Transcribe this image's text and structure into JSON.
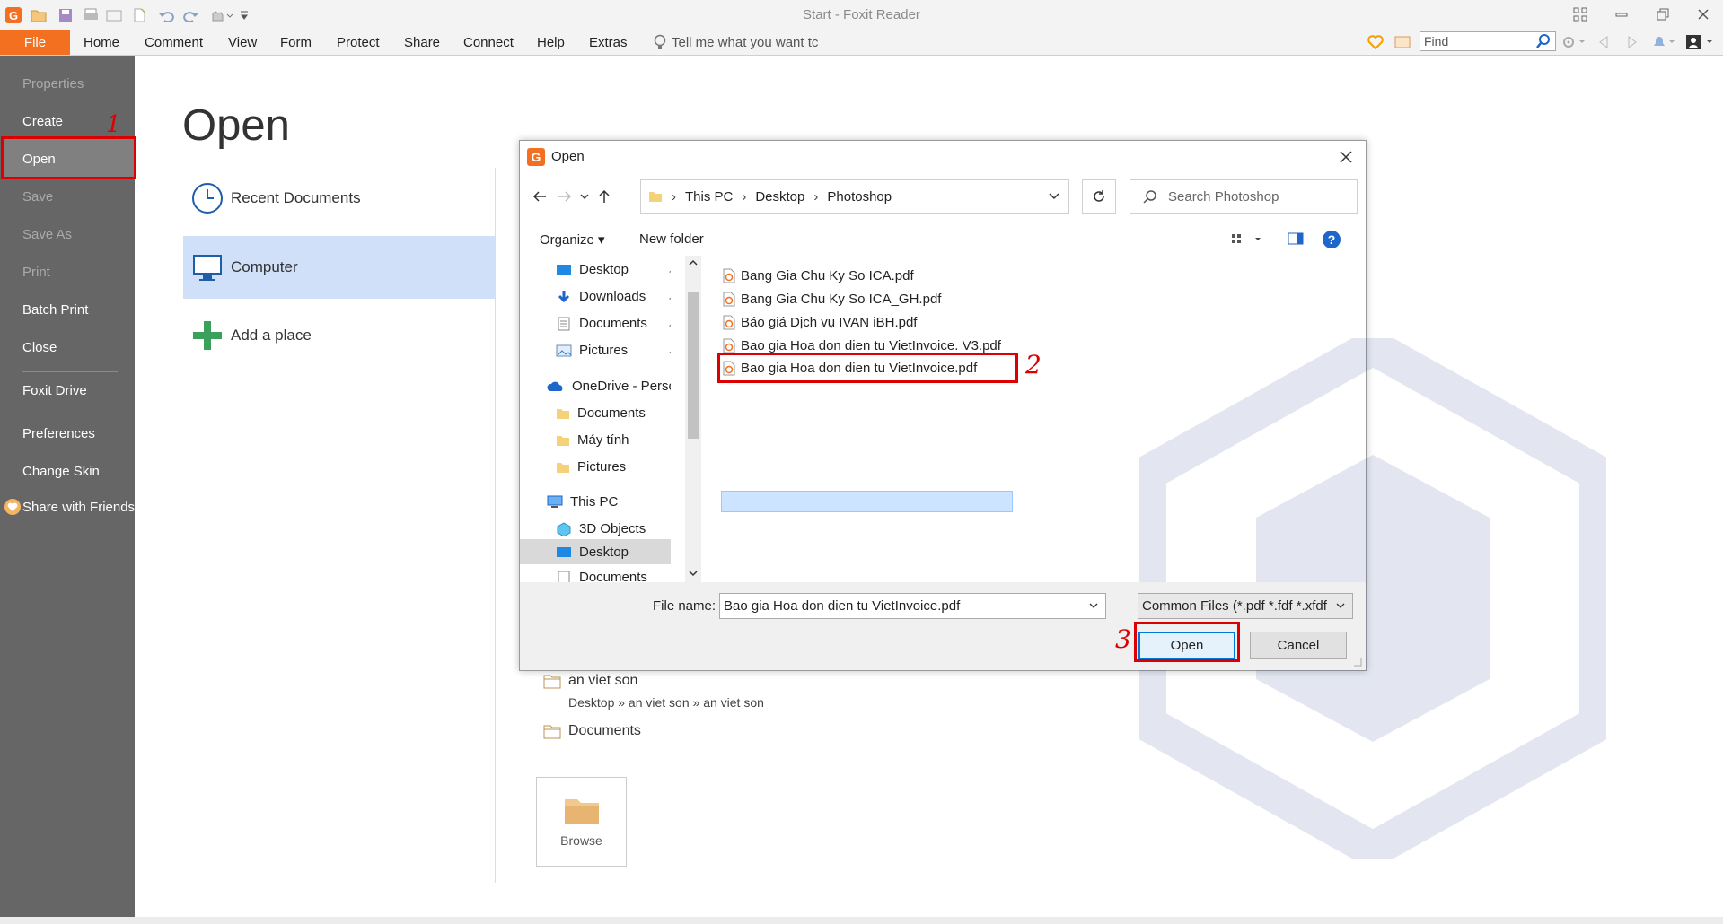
{
  "app": {
    "title": "Start - Foxit Reader"
  },
  "menu": {
    "file": "File",
    "items": [
      "Home",
      "Comment",
      "View",
      "Form",
      "Protect",
      "Share",
      "Connect",
      "Help",
      "Extras"
    ],
    "tell_me": "Tell me what you want tc",
    "find_placeholder": "Find"
  },
  "sidebar": {
    "items": [
      {
        "label": "Properties",
        "enabled": false
      },
      {
        "label": "Create",
        "enabled": true
      },
      {
        "label": "Open",
        "enabled": true,
        "selected": true
      },
      {
        "label": "Save",
        "enabled": false
      },
      {
        "label": "Save As",
        "enabled": false
      },
      {
        "label": "Print",
        "enabled": false
      },
      {
        "label": "Batch Print",
        "enabled": true
      },
      {
        "label": "Close",
        "enabled": true
      },
      {
        "label": "Foxit Drive",
        "enabled": true
      },
      {
        "label": "Preferences",
        "enabled": true
      },
      {
        "label": "Change Skin",
        "enabled": true
      },
      {
        "label": "Share with Friends",
        "enabled": true
      }
    ]
  },
  "main": {
    "title": "Open",
    "places": [
      "Recent Documents",
      "Computer",
      "Add a place"
    ],
    "recent": [
      {
        "name": "an viet son",
        "path": "Desktop » an viet son » an viet son"
      },
      {
        "name": "Documents"
      }
    ],
    "browse": "Browse"
  },
  "annotations": {
    "step1": "1",
    "step2": "2",
    "step3": "3",
    "accent": "#dd0000"
  },
  "dialog": {
    "title": "Open",
    "breadcrumb": [
      "This PC",
      "Desktop",
      "Photoshop"
    ],
    "search_placeholder": "Search Photoshop",
    "organize": "Organize",
    "new_folder": "New folder",
    "tree": [
      {
        "label": "Desktop",
        "icon": "desktop-icon",
        "pinned": true
      },
      {
        "label": "Downloads",
        "icon": "download-icon",
        "pinned": true
      },
      {
        "label": "Documents",
        "icon": "documents-icon",
        "pinned": true
      },
      {
        "label": "Pictures",
        "icon": "pictures-icon",
        "pinned": true
      },
      {
        "label": "OneDrive - Personal",
        "icon": "onedrive-icon"
      },
      {
        "label": "Documents",
        "icon": "folder-icon"
      },
      {
        "label": "Máy tính",
        "icon": "folder-icon"
      },
      {
        "label": "Pictures",
        "icon": "folder-icon"
      },
      {
        "label": "This PC",
        "icon": "pc-icon"
      },
      {
        "label": "3D Objects",
        "icon": "3d-objects-icon"
      },
      {
        "label": "Desktop",
        "icon": "desktop-icon",
        "selected": true
      },
      {
        "label": "Documents",
        "icon": "documents-icon"
      }
    ],
    "files": [
      "Bang Gia Chu Ky So ICA.pdf",
      "Bang Gia Chu Ky So ICA_GH.pdf",
      "Báo giá Dịch vụ IVAN iBH.pdf",
      "Bao gia Hoa don dien tu VietInvoice. V3.pdf",
      "Bao gia Hoa don dien tu VietInvoice.pdf"
    ],
    "selected_file_index": 4,
    "file_name_label": "File name:",
    "file_name_value": "Bao gia Hoa don dien tu VietInvoice.pdf",
    "file_type": "Common Files (*.pdf *.fdf *.xfdf",
    "open_button": "Open",
    "cancel_button": "Cancel"
  }
}
